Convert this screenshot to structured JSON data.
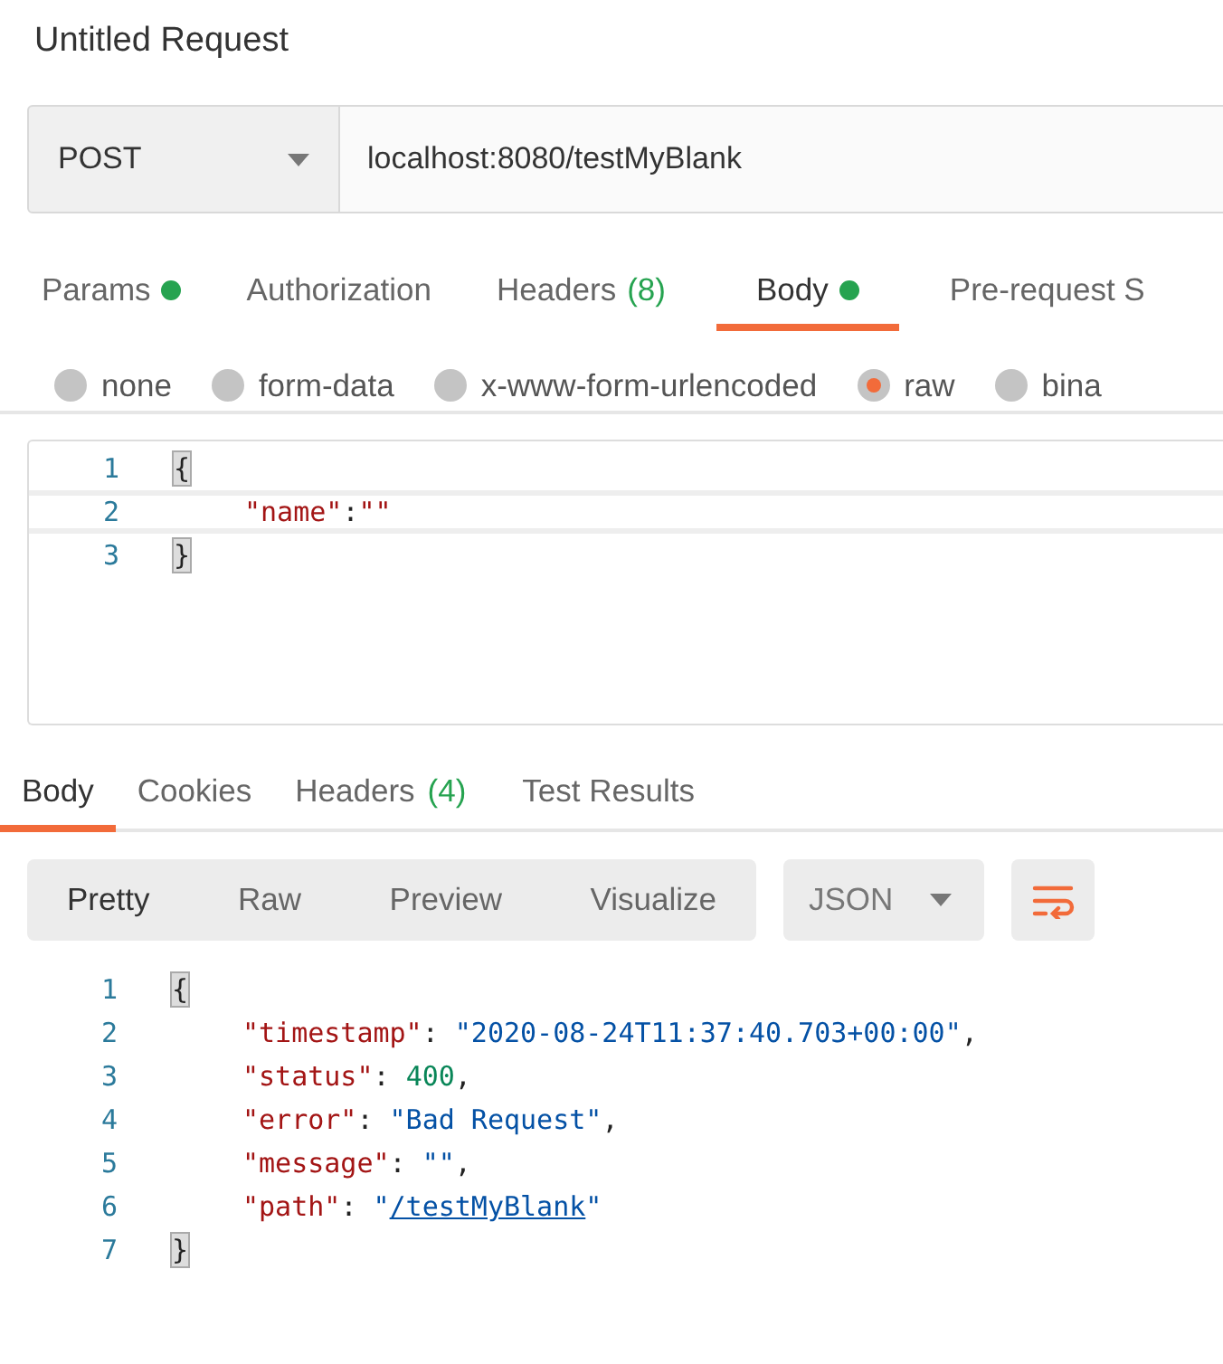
{
  "title": "Untitled Request",
  "request": {
    "method": "POST",
    "url": "localhost:8080/testMyBlank"
  },
  "request_tabs": [
    {
      "label": "Params",
      "dot": true,
      "selected": false
    },
    {
      "label": "Authorization",
      "dot": false,
      "selected": false
    },
    {
      "label": "Headers",
      "dot": false,
      "count": "(8)",
      "selected": false
    },
    {
      "label": "Body",
      "dot": true,
      "selected": true
    },
    {
      "label": "Pre-request S",
      "dot": false,
      "selected": false
    }
  ],
  "body_types": [
    {
      "label": "none",
      "selected": false
    },
    {
      "label": "form-data",
      "selected": false
    },
    {
      "label": "x-www-form-urlencoded",
      "selected": false
    },
    {
      "label": "raw",
      "selected": true
    },
    {
      "label": "bina",
      "selected": false
    }
  ],
  "request_body": [
    {
      "number": "1",
      "indent": false,
      "current": false,
      "tokens": [
        {
          "kind": "brace",
          "text": "{"
        }
      ]
    },
    {
      "number": "2",
      "indent": true,
      "current": true,
      "tokens": [
        {
          "kind": "key",
          "text": "\"name\""
        },
        {
          "kind": "punct",
          "text": ":"
        },
        {
          "kind": "key",
          "text": "\"\""
        }
      ]
    },
    {
      "number": "3",
      "indent": false,
      "current": false,
      "tokens": [
        {
          "kind": "brace",
          "text": "}"
        }
      ]
    }
  ],
  "response_tabs": [
    {
      "label": "Body",
      "selected": true
    },
    {
      "label": "Cookies",
      "selected": false
    },
    {
      "label": "Headers",
      "count": "(4)",
      "selected": false
    },
    {
      "label": "Test Results",
      "selected": false
    }
  ],
  "view_modes": [
    {
      "label": "Pretty",
      "selected": true
    },
    {
      "label": "Raw",
      "selected": false
    },
    {
      "label": "Preview",
      "selected": false
    },
    {
      "label": "Visualize",
      "selected": false
    }
  ],
  "format": "JSON",
  "response_body": [
    {
      "number": "1",
      "indent": false,
      "tokens": [
        {
          "kind": "brace",
          "text": "{"
        }
      ]
    },
    {
      "number": "2",
      "indent": true,
      "tokens": [
        {
          "kind": "key",
          "text": "\"timestamp\""
        },
        {
          "kind": "punct",
          "text": ": "
        },
        {
          "kind": "string",
          "text": "\"2020-08-24T11:37:40.703+00:00\""
        },
        {
          "kind": "punct",
          "text": ","
        }
      ]
    },
    {
      "number": "3",
      "indent": true,
      "tokens": [
        {
          "kind": "key",
          "text": "\"status\""
        },
        {
          "kind": "punct",
          "text": ": "
        },
        {
          "kind": "number",
          "text": "400"
        },
        {
          "kind": "punct",
          "text": ","
        }
      ]
    },
    {
      "number": "4",
      "indent": true,
      "tokens": [
        {
          "kind": "key",
          "text": "\"error\""
        },
        {
          "kind": "punct",
          "text": ": "
        },
        {
          "kind": "string",
          "text": "\"Bad Request\""
        },
        {
          "kind": "punct",
          "text": ","
        }
      ]
    },
    {
      "number": "5",
      "indent": true,
      "tokens": [
        {
          "kind": "key",
          "text": "\"message\""
        },
        {
          "kind": "punct",
          "text": ": "
        },
        {
          "kind": "string",
          "text": "\"\""
        },
        {
          "kind": "punct",
          "text": ","
        }
      ]
    },
    {
      "number": "6",
      "indent": true,
      "tokens": [
        {
          "kind": "key",
          "text": "\"path\""
        },
        {
          "kind": "punct",
          "text": ": "
        },
        {
          "kind": "string",
          "text": "\""
        },
        {
          "kind": "link",
          "text": "/testMyBlank"
        },
        {
          "kind": "string",
          "text": "\""
        }
      ]
    },
    {
      "number": "7",
      "indent": false,
      "tokens": [
        {
          "kind": "brace",
          "text": "}"
        }
      ]
    }
  ]
}
